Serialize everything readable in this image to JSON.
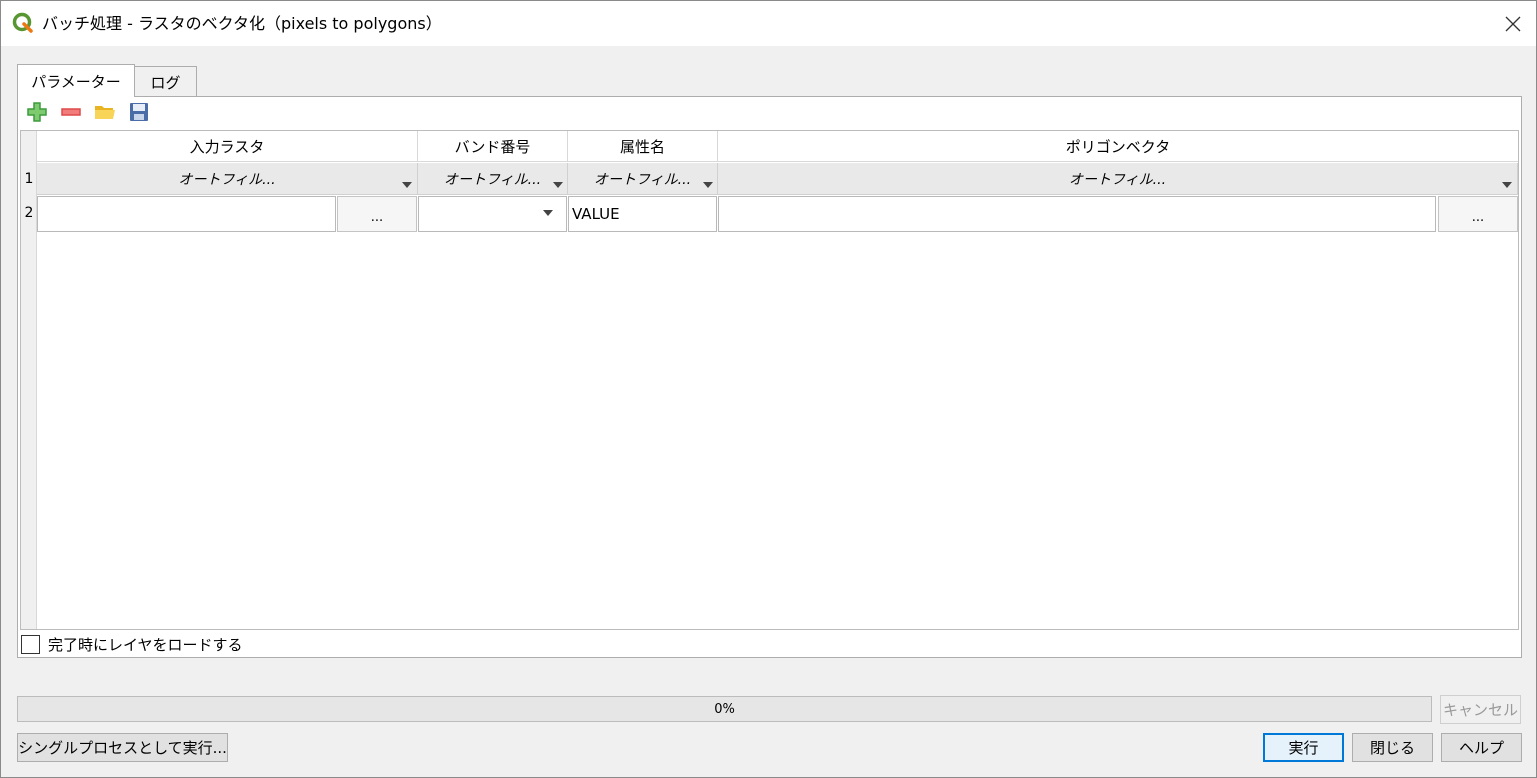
{
  "window": {
    "title": "バッチ処理 - ラスタのベクタ化（pixels to polygons）"
  },
  "tabs": [
    {
      "label": "パラメーター",
      "active": true
    },
    {
      "label": "ログ",
      "active": false
    }
  ],
  "toolbar": {
    "icons": [
      "add-row-icon",
      "remove-row-icon",
      "open-folder-icon",
      "save-icon"
    ]
  },
  "table": {
    "headers": [
      "入力ラスタ",
      "バンド番号",
      "属性名",
      "ポリゴンベクタ"
    ],
    "row_numbers": [
      "1",
      "2"
    ],
    "autofill_label": "オートフィル...",
    "autofill_labels": [
      "オートフィル...",
      "オートフィル...",
      "オートフィル...",
      "オートフィル..."
    ],
    "browse_label": "...",
    "field_name_value": "VALUE"
  },
  "load_layers": {
    "label": "完了時にレイヤをロードする",
    "checked": false
  },
  "progress": {
    "text": "0%",
    "value": 0
  },
  "buttons": {
    "cancel": "キャンセル",
    "run_single": "シングルプロセスとして実行...",
    "run": "実行",
    "close": "閉じる",
    "help": "ヘルプ"
  },
  "colors": {
    "accent": "#0078d7",
    "qgis_green": "#589632",
    "add_icon": "#3c9b3c",
    "remove_icon": "#e04848",
    "folder_icon": "#f2c230",
    "save_icon": "#4a6da7"
  }
}
